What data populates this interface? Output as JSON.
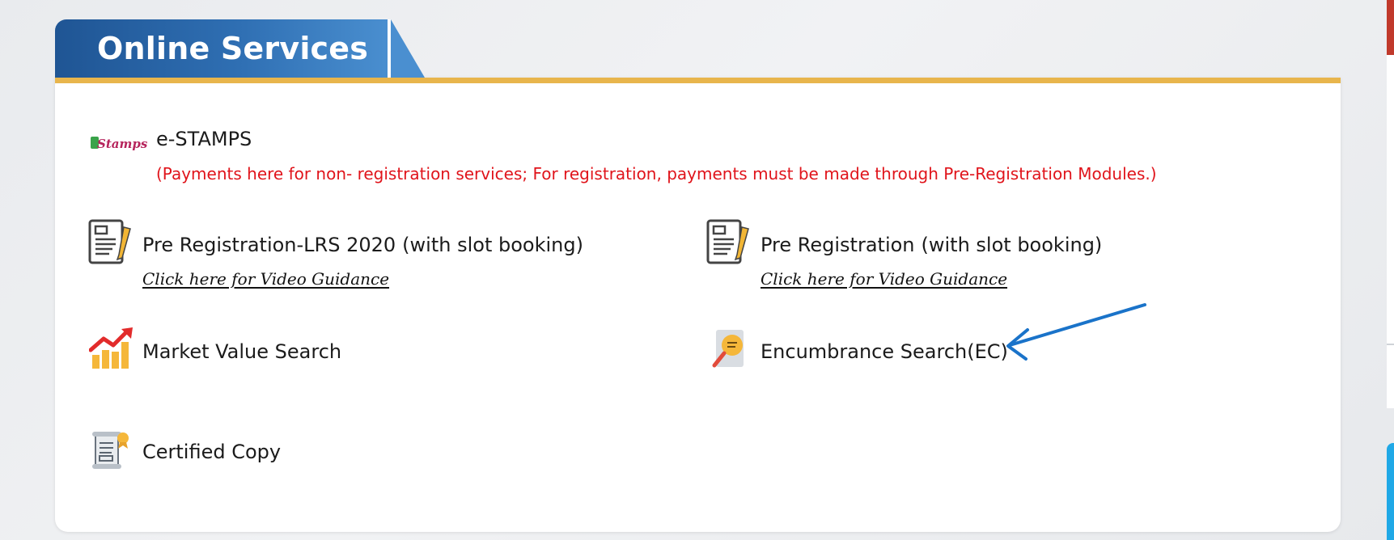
{
  "header": {
    "title": "Online Services"
  },
  "colors": {
    "header_blue": "#2f6fb3",
    "gold": "#e8b54c",
    "note_red": "#e0141b",
    "arrow_blue": "#1a73c9"
  },
  "services": {
    "estamps": {
      "label": "e-STAMPS",
      "note": "(Payments here for non- registration services; For registration, payments must be made through Pre-Registration Modules.)",
      "icon": "estamps-logo"
    },
    "pre_reg_lrs": {
      "label": "Pre Registration-LRS 2020",
      "suffix": "(with slot booking)",
      "link": "Click here for Video Guidance",
      "icon": "document-pen-icon"
    },
    "pre_reg": {
      "label": "Pre Registration",
      "suffix": "(with slot booking)",
      "link": "Click here for Video Guidance",
      "icon": "document-pen-icon"
    },
    "market_value": {
      "label": "Market Value Search",
      "icon": "chart-growth-icon"
    },
    "encumbrance": {
      "label": "Encumbrance Search(EC)",
      "icon": "magnifier-document-icon"
    },
    "certified_copy": {
      "label": "Certified Copy",
      "icon": "certificate-scroll-icon"
    }
  }
}
